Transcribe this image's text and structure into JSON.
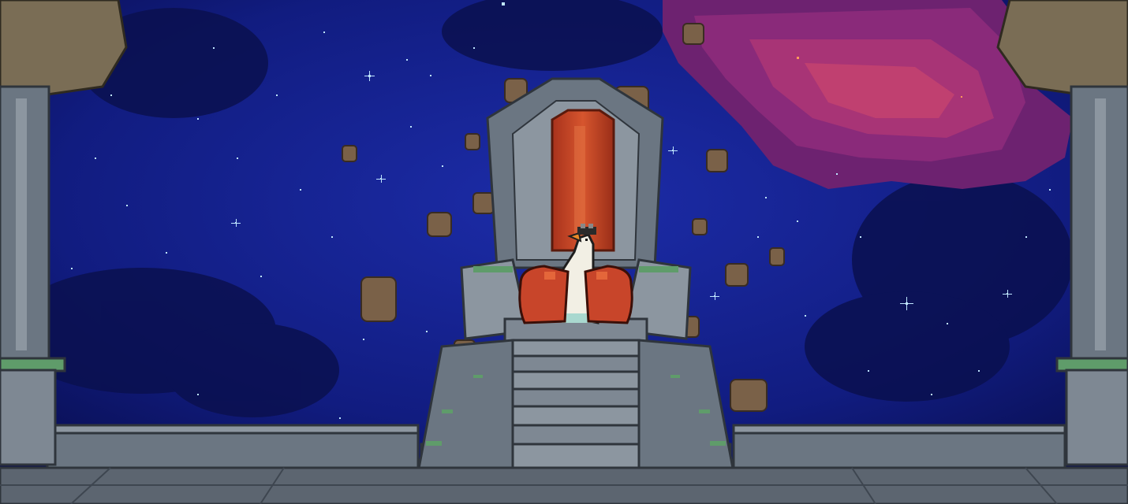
{
  "scene": {
    "description_text": "",
    "palette": {
      "sky_deep": "#0a0f55",
      "sky_mid": "#1a2a9a",
      "nebula_magenta": "#8a2a7a",
      "nebula_pink": "#b8306e",
      "stone_light": "#8c96a0",
      "stone_mid": "#6b7682",
      "stone_dark": "#3e4650",
      "moss_green": "#5f9c6a",
      "throne_red": "#c8452a",
      "goose_white": "#f2efe4",
      "boulder_brown": "#7a6148",
      "pillar_cap": "#7a6d55"
    },
    "objects": [
      "starry-sky",
      "nebula",
      "floating-rocks",
      "stone-throne",
      "goose",
      "boxing-gloves",
      "stone-stairs",
      "left-pillar",
      "right-pillar",
      "balustrade",
      "floor"
    ]
  }
}
